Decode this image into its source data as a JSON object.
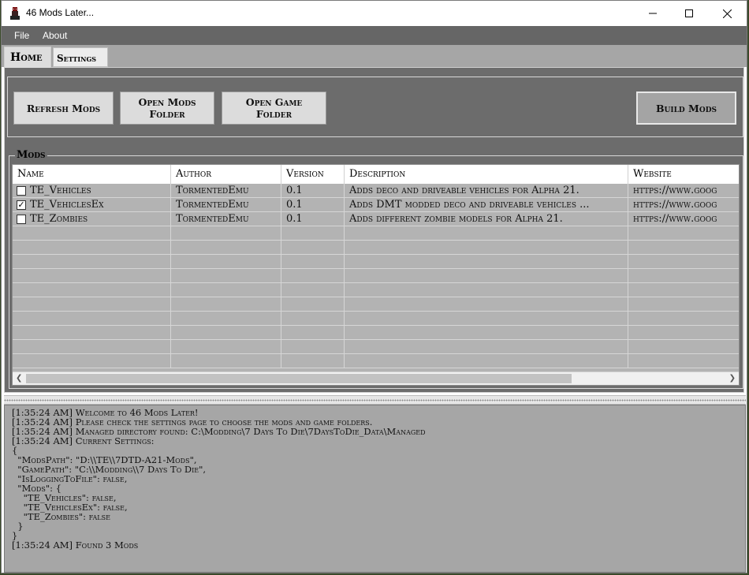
{
  "window": {
    "title": "46 Mods Later..."
  },
  "menu": {
    "file": "File",
    "about": "About"
  },
  "tabs": {
    "home": "Home",
    "settings": "Settings"
  },
  "toolbar": {
    "refresh": "Refresh Mods",
    "open_mods_1": "Open Mods",
    "open_mods_2": "Folder",
    "open_game_1": "Open Game",
    "open_game_2": "Folder",
    "build": "Build Mods"
  },
  "mods_group": {
    "label": "Mods"
  },
  "table": {
    "columns": [
      "Name",
      "Author",
      "Version",
      "Description",
      "Website"
    ],
    "rows": [
      {
        "checked": false,
        "name": "TE_Vehicles",
        "author": "TormentedEmu",
        "version": "0.1",
        "description": "Adds deco and driveable vehicles for Alpha 21.",
        "website": "https://www.goog"
      },
      {
        "checked": true,
        "name": "TE_VehiclesEx",
        "author": "TormentedEmu",
        "version": "0.1",
        "description": "Adds DMT modded deco and driveable vehicles ...",
        "website": "https://www.goog"
      },
      {
        "checked": false,
        "name": "TE_Zombies",
        "author": "TormentedEmu",
        "version": "0.1",
        "description": "Adds different zombie models for Alpha 21.",
        "website": "https://www.goog"
      }
    ]
  },
  "log": [
    "[1:35:24 AM] Welcome to 46 Mods Later!",
    "[1:35:24 AM] Please check the settings page to choose the mods and game folders.",
    "[1:35:24 AM] Managed directory found: C:\\Modding\\7 Days To Die\\7DaysToDie_Data\\Managed",
    "[1:35:24 AM] Current Settings:",
    "{",
    "  \"ModsPath\": \"D:\\\\TE\\\\7DTD-A21-Mods\",",
    "  \"GamePath\": \"C:\\\\Modding\\\\7 Days To Die\",",
    "  \"IsLoggingToFile\": false,",
    "  \"Mods\": {",
    "    \"TE_Vehicles\": false,",
    "    \"TE_VehiclesEx\": false,",
    "    \"TE_Zombies\": false",
    "  }",
    "}",
    "[1:35:24 AM] Found 3 Mods"
  ]
}
